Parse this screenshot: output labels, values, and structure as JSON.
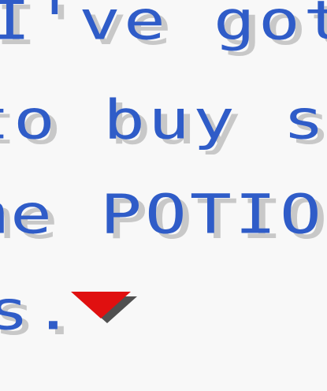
{
  "dialog": {
    "lines": [
      "I've got t",
      "to buy som",
      "me POTION",
      "s."
    ],
    "advance_indicator": "down-arrow-icon"
  },
  "colors": {
    "text": "#2f5cc8",
    "shadow": "#c8c8c8",
    "background": "#f8f8f8",
    "arrow": "#e01010",
    "arrow_shadow": "#505050"
  }
}
